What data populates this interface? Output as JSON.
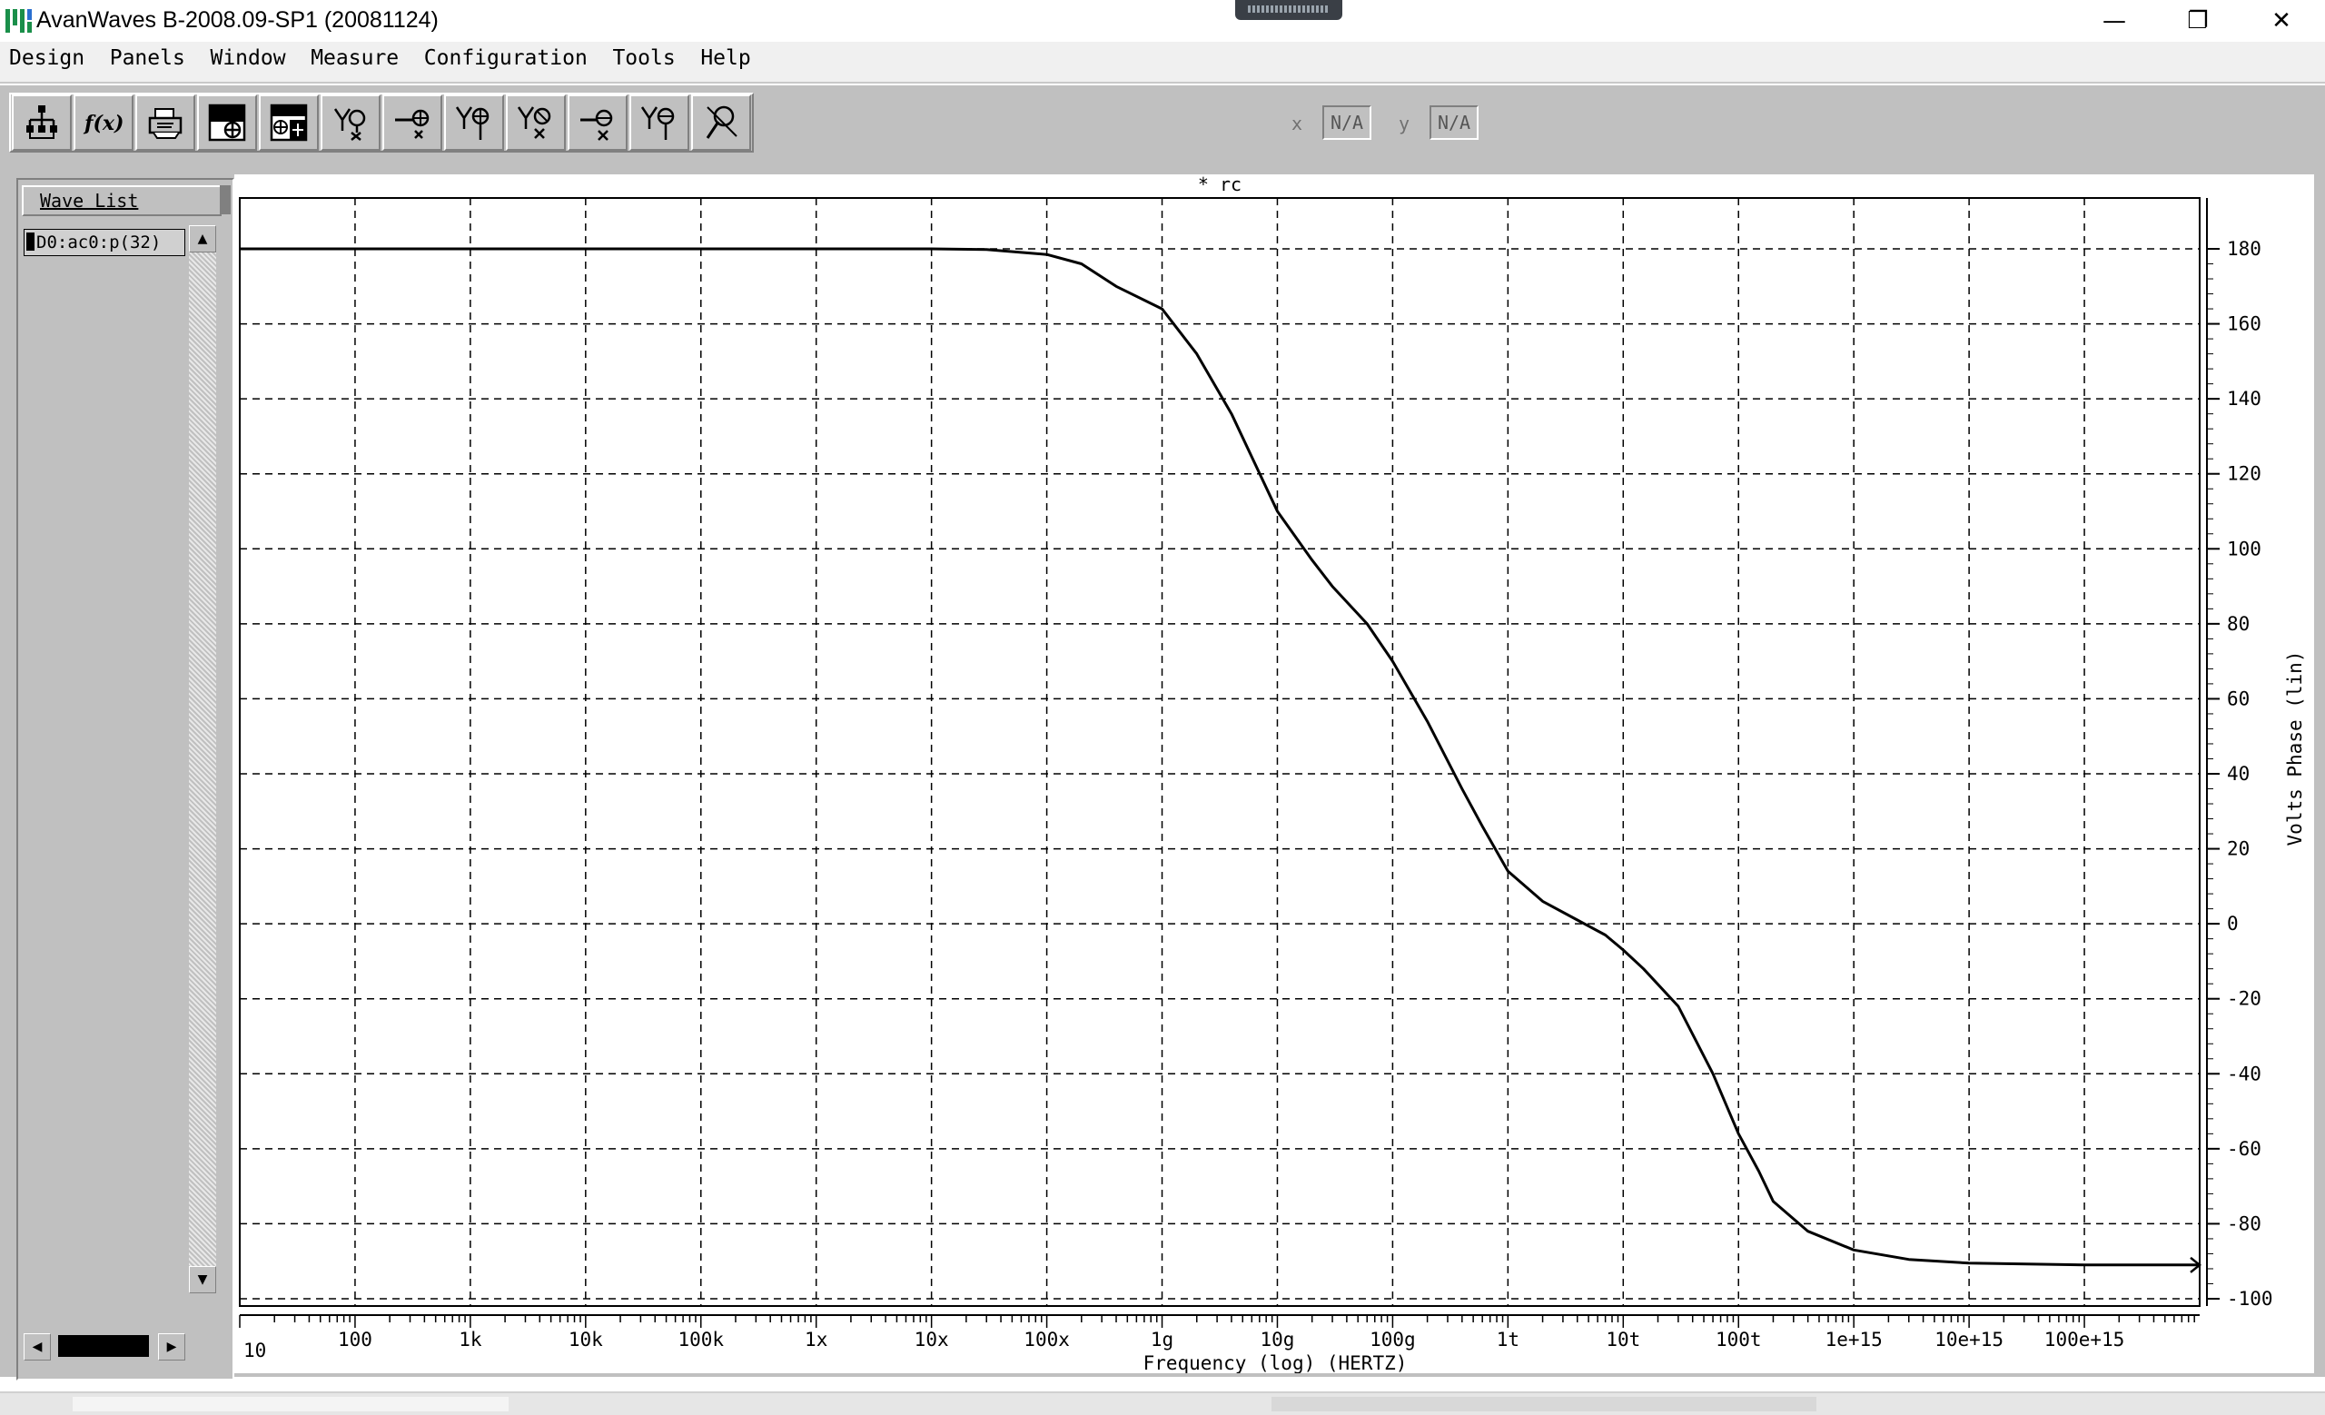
{
  "window": {
    "title": "AvanWaves B-2008.09-SP1 (20081124)",
    "controls": {
      "minimize": "—",
      "restore": "❐",
      "close": "✕"
    }
  },
  "menu": [
    {
      "label": "Design"
    },
    {
      "label": "Panels"
    },
    {
      "label": "Window"
    },
    {
      "label": "Measure"
    },
    {
      "label": "Configuration"
    },
    {
      "label": "Tools"
    },
    {
      "label": "Help"
    }
  ],
  "toolbar": {
    "buttons": [
      {
        "icon": "hierarchy-icon"
      },
      {
        "icon": "function-icon",
        "label": "f(x)"
      },
      {
        "icon": "print-icon"
      },
      {
        "icon": "add-panel-icon"
      },
      {
        "icon": "add-panels-icon"
      },
      {
        "icon": "y-cursor-delete-icon"
      },
      {
        "icon": "x-cursor-delete-icon"
      },
      {
        "icon": "y-cursor-add-icon"
      },
      {
        "icon": "y-measure-delete-icon"
      },
      {
        "icon": "x-measure-delete-icon"
      },
      {
        "icon": "y-measure-add-icon"
      },
      {
        "icon": "probe-icon"
      }
    ],
    "coords": {
      "x_label": "x",
      "x_value": "N/A",
      "y_label": "y",
      "y_value": "N/A"
    }
  },
  "wave_list": {
    "header": "Wave List",
    "items": [
      "D0:ac0:p(32)"
    ]
  },
  "chart_data": {
    "type": "line",
    "title": "* rc",
    "xlabel": "Frequency (log) (HERTZ)",
    "ylabel": "Volts Phase (lin)",
    "x_scale": "log",
    "x_range_hz": [
      10,
      1e+18
    ],
    "x_ticks": [
      {
        "value": 10,
        "label": "10"
      },
      {
        "value": 100,
        "label": "100"
      },
      {
        "value": 1000,
        "label": "1k"
      },
      {
        "value": 10000,
        "label": "10k"
      },
      {
        "value": 100000,
        "label": "100k"
      },
      {
        "value": 1000000,
        "label": "1x"
      },
      {
        "value": 10000000,
        "label": "10x"
      },
      {
        "value": 100000000,
        "label": "100x"
      },
      {
        "value": 1000000000,
        "label": "1g"
      },
      {
        "value": 10000000000,
        "label": "10g"
      },
      {
        "value": 100000000000,
        "label": "100g"
      },
      {
        "value": 1000000000000,
        "label": "1t"
      },
      {
        "value": 10000000000000,
        "label": "10t"
      },
      {
        "value": 100000000000000,
        "label": "100t"
      },
      {
        "value": 1000000000000000.0,
        "label": "1e+15"
      },
      {
        "value": 1e+16,
        "label": "10e+15"
      },
      {
        "value": 1e+17,
        "label": "100e+15"
      }
    ],
    "ylim": [
      -100,
      180
    ],
    "y_ticks": [
      180,
      160,
      140,
      120,
      100,
      80,
      60,
      40,
      20,
      0,
      -20,
      -40,
      -60,
      -80,
      -100
    ],
    "grid": true,
    "series": [
      {
        "name": "D0:ac0:p(32)",
        "points": [
          [
            10,
            180
          ],
          [
            100000.0,
            180
          ],
          [
            1000000.0,
            180
          ],
          [
            10000000.0,
            180
          ],
          [
            30000000.0,
            179.8
          ],
          [
            100000000.0,
            178.5
          ],
          [
            200000000.0,
            176
          ],
          [
            400000000.0,
            170
          ],
          [
            1000000000.0,
            164
          ],
          [
            2000000000.0,
            152
          ],
          [
            4000000000.0,
            136
          ],
          [
            10000000000.0,
            110
          ],
          [
            20000000000.0,
            97
          ],
          [
            30000000000.0,
            90
          ],
          [
            60000000000.0,
            80
          ],
          [
            100000000000.0,
            70
          ],
          [
            200000000000.0,
            54
          ],
          [
            400000000000.0,
            36
          ],
          [
            600000000000.0,
            26
          ],
          [
            1000000000000.0,
            14
          ],
          [
            2000000000000.0,
            6
          ],
          [
            4000000000000.0,
            1
          ],
          [
            7000000000000.0,
            -3
          ],
          [
            10000000000000.0,
            -7
          ],
          [
            15000000000000.0,
            -12
          ],
          [
            30000000000000.0,
            -22
          ],
          [
            60000000000000.0,
            -40
          ],
          [
            100000000000000.0,
            -56
          ],
          [
            150000000000000.0,
            -66
          ],
          [
            200000000000000.0,
            -74
          ],
          [
            400000000000000.0,
            -82
          ],
          [
            1000000000000000.0,
            -87
          ],
          [
            3000000000000000.0,
            -89.5
          ],
          [
            1e+16,
            -90.5
          ],
          [
            1e+17,
            -91
          ],
          [
            1e+18,
            -91
          ]
        ]
      }
    ]
  }
}
